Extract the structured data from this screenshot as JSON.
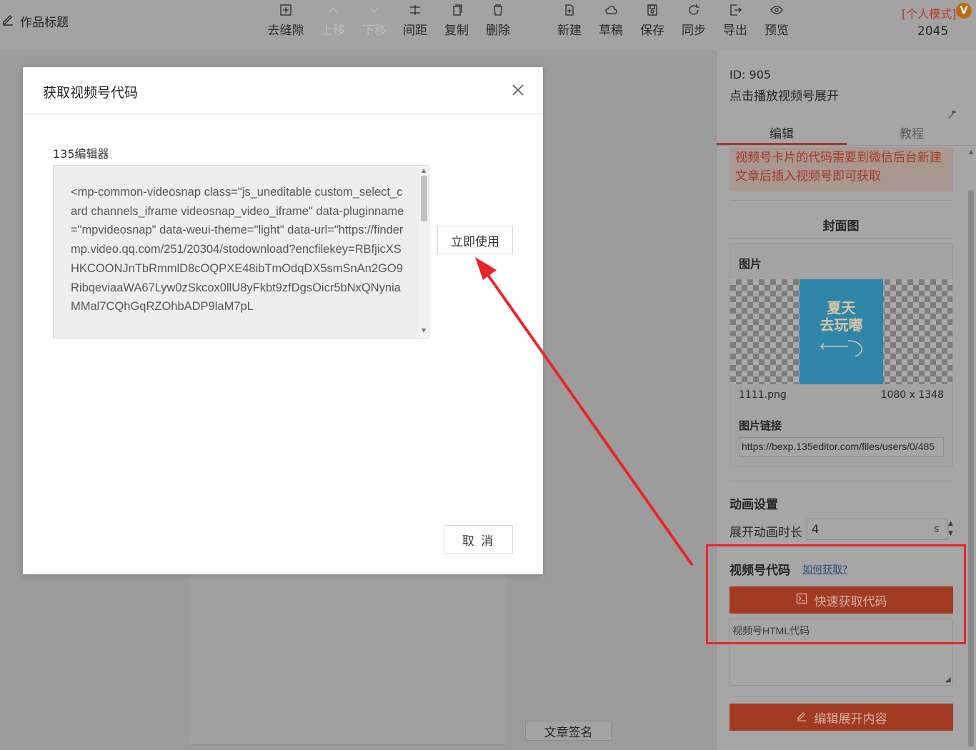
{
  "header": {
    "title": "作品标题",
    "tools": [
      {
        "label": "去缝隙",
        "icon": "grid-icon",
        "disabled": false
      },
      {
        "label": "上移",
        "icon": "chevron-up-icon",
        "disabled": true
      },
      {
        "label": "下移",
        "icon": "chevron-down-icon",
        "disabled": true
      },
      {
        "label": "间距",
        "icon": "spacing-icon",
        "disabled": false
      },
      {
        "label": "复制",
        "icon": "copy-icon",
        "disabled": false
      },
      {
        "label": "删除",
        "icon": "trash-icon",
        "disabled": false
      },
      {
        "label": "新建",
        "icon": "new-file-icon",
        "disabled": false
      },
      {
        "label": "草稿",
        "icon": "cloud-icon",
        "disabled": false
      },
      {
        "label": "保存",
        "icon": "save-icon",
        "disabled": false
      },
      {
        "label": "同步",
        "icon": "sync-icon",
        "disabled": false
      },
      {
        "label": "导出",
        "icon": "export-icon",
        "disabled": false
      },
      {
        "label": "预览",
        "icon": "eye-icon",
        "disabled": false
      }
    ],
    "mode_label": "[个人模式]",
    "vip_badge": "V",
    "count": "2045"
  },
  "canvas": {
    "signature_button": "文章签名"
  },
  "right_panel": {
    "id_label": "ID: 905",
    "component_name": "点击播放视频号展开",
    "tabs": [
      "编辑",
      "教程"
    ],
    "notice": "视频号卡片的代码需要到微信后台新建文章后插入视频号即可获取",
    "cover_heading": "封面图",
    "image_card": {
      "label": "图片",
      "thumb_text": "夏天\n去玩嘟",
      "file_name": "1111.png",
      "dimensions": "1080 x 1348",
      "link_label": "图片链接",
      "link_value": "https://bexp.135editor.com/files/users/0/485"
    },
    "animation": {
      "heading": "动画设置",
      "duration_label": "展开动画时长",
      "duration_value": "4",
      "unit": "s"
    },
    "video_code": {
      "heading": "视频号代码",
      "help_link": "如何获取?",
      "quick_button": "快速获取代码",
      "placeholder": "视频号HTML代码"
    },
    "edit_expand_button": "编辑展开内容"
  },
  "modal": {
    "title": "获取视频号代码",
    "editor_label": "135编辑器",
    "code": "<mp-common-videosnap class=\"js_uneditable custom_select_card channels_iframe videosnap_video_iframe\" data-pluginname=\"mpvideosnap\" data-weui-theme=\"light\" data-url=\"https://findermp.video.qq.com/251/20304/stodownload?encfilekey=RBfjicXSHKCOONJnTbRmmlD8cOQPXE48ibTmOdqDX5smSnAn2GO9RibqeviaaWA67Lyw0zSkcox0llU8yFkbt9zfDgsOicr5bNxQNyniaMMal7CQhGqRZOhbADP9laM7pL",
    "use_button": "立即使用",
    "cancel_button": "取 消"
  },
  "colors": {
    "accent_red": "#a33b23",
    "annotation_red": "#e8262a",
    "mode_red": "#b23b28"
  }
}
